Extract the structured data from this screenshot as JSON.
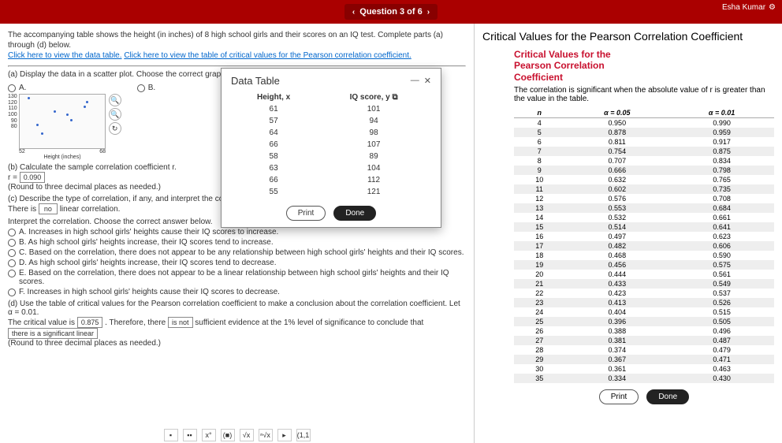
{
  "topbar": {
    "question_label": "Question 3 of 6",
    "prev": "‹",
    "next": "›",
    "user": "Esha Kumar",
    "gear": "⚙"
  },
  "intro": {
    "text": "The accompanying table shows the height (in inches) of 8 high school girls and their scores on an IQ test. Complete parts (a) through (d) below.",
    "link1": "Click here to view the data table.",
    "link2": "Click here to view the table of critical values for the Pearson correlation coefficient."
  },
  "partA": {
    "prompt": "(a) Display the data in a scatter plot. Choose the correct graph below.",
    "optA": "A.",
    "optB": "B.",
    "axis_y_top": "130",
    "axis_y_120": "120",
    "axis_y_110": "110",
    "axis_y_100": "100",
    "axis_y_90": "90",
    "axis_y_80": "80",
    "axis_x_left": "52",
    "axis_x_right": "68",
    "axis_x_label": "Height (inches)",
    "magnify": "🔍",
    "zoom": "🔍",
    "reset": "↻"
  },
  "partB": {
    "prompt": "(b) Calculate the sample correlation coefficient r.",
    "r_label": "r =",
    "r_value": "0.090",
    "round_note": "(Round to three decimal places as needed.)"
  },
  "partC": {
    "prompt": "(c) Describe the type of correlation, if any, and interpret the correlation.",
    "there_is": "There is",
    "dropdown_value": "no",
    "linear": "linear correlation.",
    "interpret_prompt": "Interpret the correlation. Choose the correct answer below.",
    "optA": "A.  Increases in high school girls' heights cause their IQ scores to increase.",
    "optB": "B.  As high school girls' heights increase, their IQ scores tend to increase.",
    "optC": "C.  Based on the correlation, there does not appear to be any relationship between high school girls' heights and their IQ scores.",
    "optD": "D.  As high school girls' heights increase, their IQ scores tend to decrease.",
    "optE": "E.  Based on the correlation, there does not appear to be a linear relationship between high school girls' heights and their IQ scores.",
    "optF": "F.  Increases in high school girls' heights cause their IQ scores to decrease."
  },
  "partD": {
    "prompt": "(d) Use the table of critical values for the Pearson correlation coefficient to make a conclusion about the correlation coefficient. Let α = 0.01.",
    "sentence_1": "The critical value is",
    "crit_value": "0.875",
    "sentence_2": ". Therefore, there",
    "is_not": "is not",
    "sentence_3": "sufficient evidence at the 1% level of significance to conclude that",
    "conclusion_box": "there is a significant linear",
    "round_note": "(Round to three decimal places as needed.)"
  },
  "modal": {
    "title": "Data Table",
    "minimize": "—",
    "close": "✕",
    "col1": "Height, x",
    "col2": "IQ score, y",
    "copy_icon": "⧉",
    "rows": [
      {
        "x": "61",
        "y": "101"
      },
      {
        "x": "57",
        "y": "94"
      },
      {
        "x": "64",
        "y": "98"
      },
      {
        "x": "66",
        "y": "107"
      },
      {
        "x": "58",
        "y": "89"
      },
      {
        "x": "63",
        "y": "104"
      },
      {
        "x": "66",
        "y": "112"
      },
      {
        "x": "55",
        "y": "121"
      }
    ],
    "print": "Print",
    "done": "Done"
  },
  "right": {
    "title": "Critical Values for the Pearson Correlation Coefficient",
    "heading1": "Critical Values for the",
    "heading2": "Pearson Correlation",
    "heading3": "Coefficient",
    "sub": "The correlation is significant when the absolute value of r is greater than the value in the table.",
    "th_n": "n",
    "th_05": "α = 0.05",
    "th_01": "α = 0.01",
    "rows": [
      {
        "n": "4",
        "a": "0.950",
        "b": "0.990"
      },
      {
        "n": "5",
        "a": "0.878",
        "b": "0.959"
      },
      {
        "n": "6",
        "a": "0.811",
        "b": "0.917"
      },
      {
        "n": "7",
        "a": "0.754",
        "b": "0.875"
      },
      {
        "n": "8",
        "a": "0.707",
        "b": "0.834"
      },
      {
        "n": "9",
        "a": "0.666",
        "b": "0.798"
      },
      {
        "n": "10",
        "a": "0.632",
        "b": "0.765"
      },
      {
        "n": "11",
        "a": "0.602",
        "b": "0.735"
      },
      {
        "n": "12",
        "a": "0.576",
        "b": "0.708"
      },
      {
        "n": "13",
        "a": "0.553",
        "b": "0.684"
      },
      {
        "n": "14",
        "a": "0.532",
        "b": "0.661"
      },
      {
        "n": "15",
        "a": "0.514",
        "b": "0.641"
      },
      {
        "n": "16",
        "a": "0.497",
        "b": "0.623"
      },
      {
        "n": "17",
        "a": "0.482",
        "b": "0.606"
      },
      {
        "n": "18",
        "a": "0.468",
        "b": "0.590"
      },
      {
        "n": "19",
        "a": "0.456",
        "b": "0.575"
      },
      {
        "n": "20",
        "a": "0.444",
        "b": "0.561"
      },
      {
        "n": "21",
        "a": "0.433",
        "b": "0.549"
      },
      {
        "n": "22",
        "a": "0.423",
        "b": "0.537"
      },
      {
        "n": "23",
        "a": "0.413",
        "b": "0.526"
      },
      {
        "n": "24",
        "a": "0.404",
        "b": "0.515"
      },
      {
        "n": "25",
        "a": "0.396",
        "b": "0.505"
      },
      {
        "n": "26",
        "a": "0.388",
        "b": "0.496"
      },
      {
        "n": "27",
        "a": "0.381",
        "b": "0.487"
      },
      {
        "n": "28",
        "a": "0.374",
        "b": "0.479"
      },
      {
        "n": "29",
        "a": "0.367",
        "b": "0.471"
      },
      {
        "n": "30",
        "a": "0.361",
        "b": "0.463"
      },
      {
        "n": "35",
        "a": "0.334",
        "b": "0.430"
      }
    ],
    "print": "Print",
    "done": "Done"
  },
  "toolbar": {
    "b1": "▪",
    "b2": "▪▪",
    "b3": "x°",
    "b4": "(■)",
    "b5": "√x",
    "b6": "ⁿ√x",
    "b7": "▸",
    "b8": "(1,1"
  }
}
